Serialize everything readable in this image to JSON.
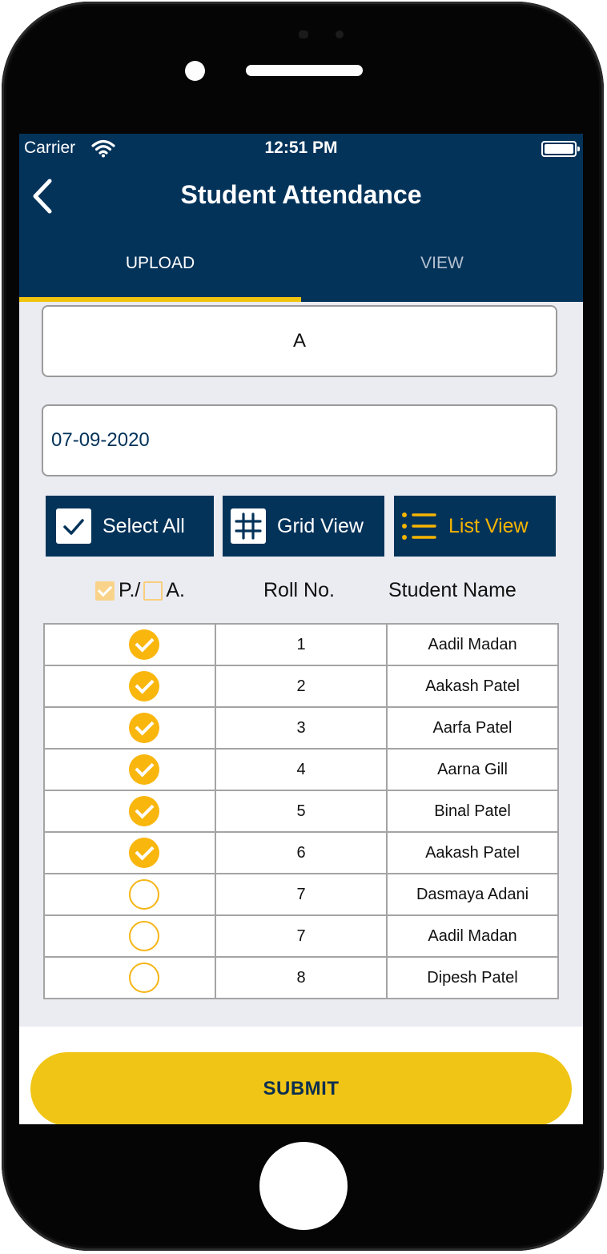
{
  "status_bar": {
    "carrier": "Carrier",
    "time": "12:51 PM"
  },
  "header": {
    "title": "Student Attendance"
  },
  "tabs": [
    {
      "label": "UPLOAD",
      "active": true
    },
    {
      "label": "VIEW",
      "active": false
    }
  ],
  "form": {
    "section_value": "A",
    "date_value": "07-09-2020"
  },
  "actions": {
    "select_all": "Select All",
    "grid_view": "Grid View",
    "list_view": "List View"
  },
  "columns": {
    "present": "P./",
    "absent": "A.",
    "roll": "Roll No.",
    "name": "Student Name"
  },
  "students": [
    {
      "present": true,
      "roll": "1",
      "name": "Aadil Madan"
    },
    {
      "present": true,
      "roll": "2",
      "name": "Aakash Patel"
    },
    {
      "present": true,
      "roll": "3",
      "name": "Aarfa Patel"
    },
    {
      "present": true,
      "roll": "4",
      "name": "Aarna Gill"
    },
    {
      "present": true,
      "roll": "5",
      "name": "Binal Patel"
    },
    {
      "present": true,
      "roll": "6",
      "name": "Aakash Patel"
    },
    {
      "present": false,
      "roll": "7",
      "name": "Dasmaya Adani"
    },
    {
      "present": false,
      "roll": "7",
      "name": "Aadil Madan"
    },
    {
      "present": false,
      "roll": "8",
      "name": "Dipesh  Patel"
    }
  ],
  "submit_label": "SUBMIT",
  "colors": {
    "primary": "#04335a",
    "accent": "#f1c40f",
    "check": "#f9b60d"
  },
  "icons": {
    "back": "chevron-left-icon",
    "wifi": "wifi-icon",
    "battery": "battery-icon",
    "select_all": "checkbox-icon",
    "grid_view": "grid-icon",
    "list_view": "list-icon"
  }
}
